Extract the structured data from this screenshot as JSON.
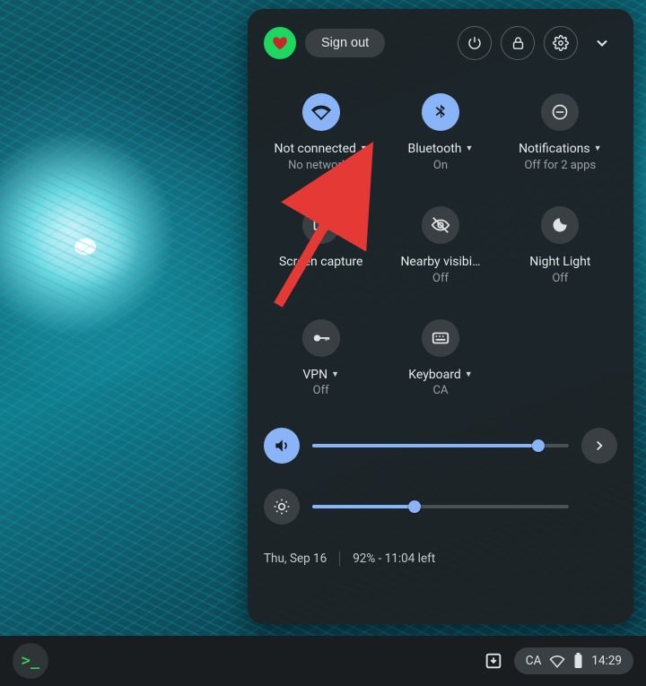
{
  "header": {
    "sign_out": "Sign out"
  },
  "tiles": {
    "network": {
      "label": "Not connected",
      "sub": "No networks",
      "has_caret": true,
      "state": "on"
    },
    "bluetooth": {
      "label": "Bluetooth",
      "sub": "On",
      "has_caret": true,
      "state": "on"
    },
    "notifications": {
      "label": "Notifications",
      "sub": "Off for 2 apps",
      "has_caret": true,
      "state": "off"
    },
    "screen_capture": {
      "label": "Screen capture",
      "sub": "",
      "has_caret": false,
      "state": "off"
    },
    "nearby": {
      "label": "Nearby visibi…",
      "sub": "Off",
      "has_caret": false,
      "state": "off"
    },
    "night_light": {
      "label": "Night Light",
      "sub": "Off",
      "has_caret": false,
      "state": "off"
    },
    "vpn": {
      "label": "VPN",
      "sub": "Off",
      "has_caret": true,
      "state": "off"
    },
    "keyboard": {
      "label": "Keyboard",
      "sub": "CA",
      "has_caret": true,
      "state": "off"
    }
  },
  "sliders": {
    "volume": {
      "value": 88
    },
    "brightness": {
      "value": 40
    }
  },
  "footer": {
    "date": "Thu, Sep 16",
    "battery": "92% - 11:04 left"
  },
  "shelf": {
    "ime": "CA",
    "time": "14:29"
  }
}
